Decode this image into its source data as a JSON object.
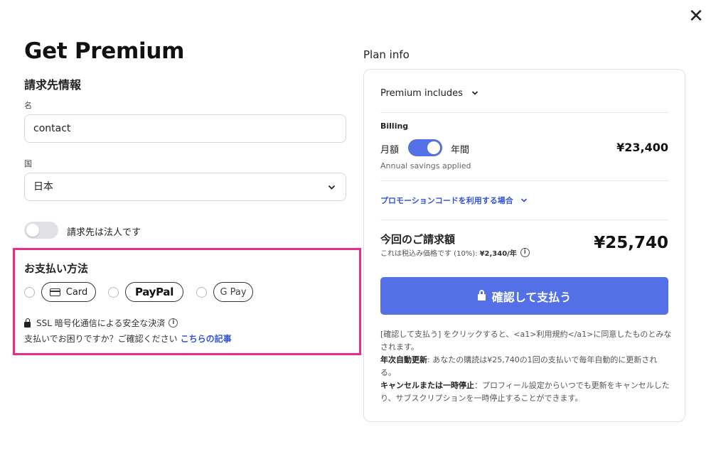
{
  "header": {
    "title": "Get Premium",
    "close_glyph": "✕"
  },
  "billing_form": {
    "section_title": "請求先情報",
    "name_label": "名",
    "name_value": "contact",
    "country_label": "国",
    "country_value": "日本",
    "corporate_toggle_label": "請求先は法人です",
    "corporate_toggle_on": false
  },
  "payment": {
    "title": "お支払い方法",
    "methods": [
      "Card",
      "PayPal",
      "G Pay"
    ],
    "ssl_text": "SSL 暗号化通信による安全な決済",
    "help_text": "支払いでお困りですか？ご確認ください",
    "help_link": "こちらの記事",
    "highlight_color": "#ea2b8d"
  },
  "plan": {
    "heading": "Plan info",
    "includes_label": "Premium includes",
    "billing_label": "Billing",
    "monthly_label": "月額",
    "annual_label": "年間",
    "billing_toggle_annual": true,
    "billing_price": "¥23,400",
    "savings_text": "Annual savings applied",
    "promo_text": "プロモーションコードを利用する場合",
    "total_label": "今回のご請求額",
    "tax_note": "これは税込み価格です (10%):",
    "tax_amount": "¥2,340/年",
    "total_price": "¥25,740",
    "confirm_label": "確認して支払う",
    "accent_color": "#5470e6",
    "terms": {
      "line1": "[確認して支払う] をクリックすると、<a1>利用規約</a1>に同意したものとみなされます。",
      "auto_renew_label": "年次自動更新",
      "auto_renew_text": ": あなたの購読は¥25,740の1回の支払いで毎年自動的に更新される。",
      "cancel_label": "キャンセルまたは一時停止",
      "cancel_text": "：プロフィール設定からいつでも更新をキャンセルしたり、サブスクリプションを一時停止することができます。"
    }
  },
  "icons": {
    "chevron_down": "⌄",
    "info": "i",
    "google_g": "G"
  }
}
